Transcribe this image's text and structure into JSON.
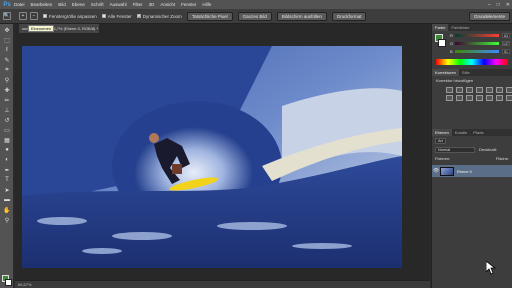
{
  "menubar": {
    "logo": "Ps",
    "items": [
      "Datei",
      "Bearbeiten",
      "Bild",
      "Ebene",
      "Schrift",
      "Auswahl",
      "Filter",
      "3D",
      "Ansicht",
      "Fenster",
      "Hilfe"
    ],
    "window_controls": [
      "–",
      "□",
      "✕"
    ]
  },
  "options": {
    "checks": [
      {
        "label": "Fenstergröße anpassen",
        "checked": false
      },
      {
        "label": "Alle Fenster",
        "checked": false
      },
      {
        "label": "Dynamischer Zoom",
        "checked": true
      }
    ],
    "buttons": [
      "Tatsächliche Pixel",
      "Ganzes Bild",
      "Bildschirm ausfüllen",
      "Druckformat"
    ],
    "workspace": "Grundelemente"
  },
  "document": {
    "tab_label": "surf…09.jpg bei 66,7% (Ebene 0, RGB/8) *",
    "tooltip": "Einzoomen",
    "status": "66,67%"
  },
  "color_panel": {
    "tabs": [
      "Farbe",
      "Farbfelder"
    ],
    "sliders": [
      {
        "label": "R",
        "value": "63",
        "color": "#c14040"
      },
      {
        "label": "G",
        "value": "137",
        "color": "#3aa040"
      },
      {
        "label": "B",
        "value": "51",
        "color": "#3a4fc0"
      }
    ]
  },
  "adjust_panel": {
    "tabs": [
      "Korrekturen",
      "Stile"
    ],
    "title": "Korrektur hinzufügen"
  },
  "layers_panel": {
    "tabs": [
      "Ebenen",
      "Kanäle",
      "Pfade"
    ],
    "kind": "Art",
    "blend_mode": "Normal",
    "opacity_label": "Deckkraft:",
    "fix_label": "Fixieren:",
    "fill_label": "Fläche:",
    "layer_name": "Ebene 0"
  },
  "colors": {
    "fg": "#3c8a37",
    "bg": "#ffffff",
    "accent": "#4aa0e6"
  }
}
